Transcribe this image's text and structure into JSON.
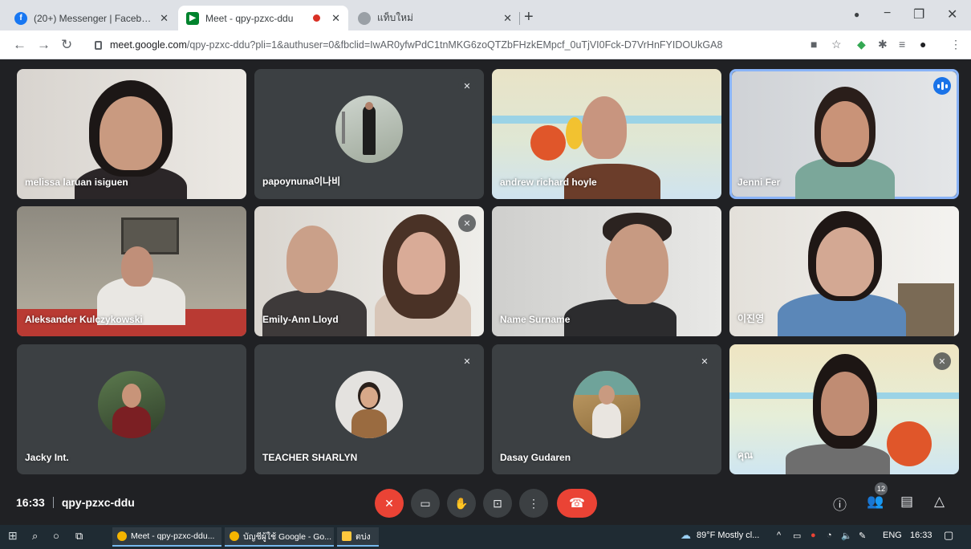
{
  "browser": {
    "tabs": [
      {
        "title": "(20+) Messenger | Facebook",
        "close": "✕"
      },
      {
        "title": "Meet - qpy-pzxc-ddu",
        "close": "✕"
      },
      {
        "title": "แท็บใหม่",
        "close": "✕"
      }
    ],
    "new_tab": "+",
    "window_controls": {
      "minimize": "−",
      "maximize": "❐",
      "close": "✕"
    },
    "url_host": "meet.google.com",
    "url_path": "/qpy-pzxc-ddu?pli=1&authuser=0&fbclid=IwAR0yfwPdC1tnMKG6zoQTZbFHzkEMpcf_0uTjVI0Fck-D7VrHnFYIDOUkGA8"
  },
  "participants": [
    {
      "name": "melissa laruan isiguen",
      "muted": false
    },
    {
      "name": "papoynuna이나비",
      "muted": true
    },
    {
      "name": "andrew richard hoyle",
      "muted": false
    },
    {
      "name": "Jenni Fer",
      "muted": false,
      "speaking": true
    },
    {
      "name": "Aleksander Kulczykowski",
      "muted": false
    },
    {
      "name": "Emily-Ann Lloyd",
      "muted": true
    },
    {
      "name": "Name Surname",
      "muted": false
    },
    {
      "name": "이진영",
      "muted": false
    },
    {
      "name": "Jacky Int.",
      "muted": false
    },
    {
      "name": "TEACHER SHARLYN",
      "muted": true
    },
    {
      "name": "Dasay Gudaren",
      "muted": true
    },
    {
      "name": "คุณ",
      "muted": true
    }
  ],
  "meeting": {
    "time": "16:33",
    "code": "qpy-pzxc-ddu",
    "participant_count": "12"
  },
  "taskbar": {
    "apps": [
      "Meet - qpy-pzxc-ddu...",
      "บัญชีผู้ใช้ Google - Go...",
      "ตบ่ง"
    ],
    "weather": "89°F  Mostly cl...",
    "lang": "ENG",
    "clock": "16:33"
  },
  "colors": {
    "accent": "#1a73e8",
    "danger": "#ea4335",
    "tile": "#3c4043",
    "stage": "#202124"
  }
}
